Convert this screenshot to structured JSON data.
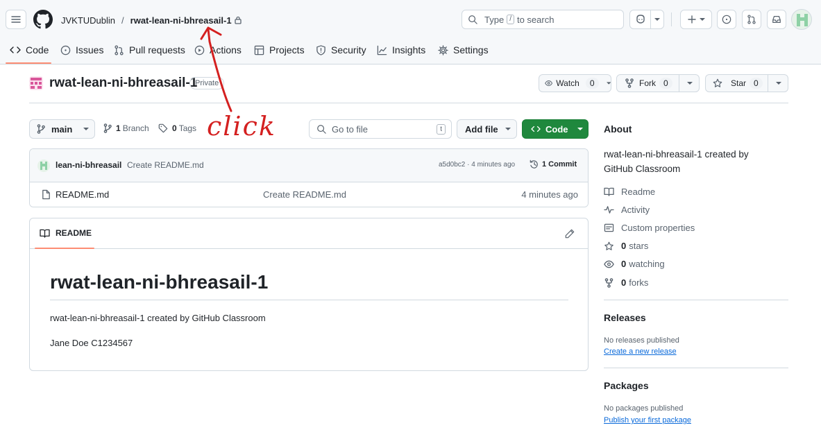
{
  "header": {
    "owner": "JVKTUDublin",
    "separator": "/",
    "repo": "rwat-lean-ni-bhreasail-1",
    "search_prefix": "Type",
    "search_key": "/",
    "search_suffix": "to search"
  },
  "tabs": [
    {
      "label": "Code",
      "icon": "code-icon"
    },
    {
      "label": "Issues",
      "icon": "issue-icon"
    },
    {
      "label": "Pull requests",
      "icon": "pull-request-icon"
    },
    {
      "label": "Actions",
      "icon": "play-icon"
    },
    {
      "label": "Projects",
      "icon": "table-icon"
    },
    {
      "label": "Security",
      "icon": "shield-icon"
    },
    {
      "label": "Insights",
      "icon": "graph-icon"
    },
    {
      "label": "Settings",
      "icon": "gear-icon"
    }
  ],
  "repo": {
    "name": "rwat-lean-ni-bhreasail-1",
    "visibility": "Private",
    "watch_label": "Watch",
    "watch_count": "0",
    "fork_label": "Fork",
    "fork_count": "0",
    "star_label": "Star",
    "star_count": "0"
  },
  "toolbar": {
    "branch": "main",
    "branch_count": "1",
    "branch_label": "Branch",
    "tag_count": "0",
    "tag_label": "Tags",
    "goto_placeholder": "Go to file",
    "goto_key": "t",
    "add_file": "Add file",
    "code": "Code"
  },
  "commit": {
    "author": "lean-ni-bhreasail",
    "message": "Create README.md",
    "sha_time": "a5d0bc2 · 4 minutes ago",
    "count_label": "1 Commit"
  },
  "files": [
    {
      "name": "README.md",
      "message": "Create README.md",
      "time": "4 minutes ago"
    }
  ],
  "readme": {
    "tab_label": "README",
    "heading": "rwat-lean-ni-bhreasail-1",
    "line1": "rwat-lean-ni-bhreasail-1 created by GitHub Classroom",
    "line2": "Jane Doe C1234567"
  },
  "about": {
    "title": "About",
    "description": "rwat-lean-ni-bhreasail-1 created by GitHub Classroom",
    "links": [
      {
        "label": "Readme",
        "icon": "book-icon"
      },
      {
        "label": "Activity",
        "icon": "pulse-icon"
      },
      {
        "label": "Custom properties",
        "icon": "note-icon"
      }
    ],
    "stars_count": "0",
    "stars_label": "stars",
    "watching_count": "0",
    "watching_label": "watching",
    "forks_count": "0",
    "forks_label": "forks"
  },
  "releases": {
    "title": "Releases",
    "empty": "No releases published",
    "link": "Create a new release"
  },
  "packages": {
    "title": "Packages",
    "empty": "No packages published",
    "link": "Publish your first package"
  },
  "annotation": {
    "text": "click",
    "color": "#d42020"
  },
  "colors": {
    "accent_tab": "#fd8c73",
    "code_button": "#1f883d",
    "link": "#0969da"
  }
}
